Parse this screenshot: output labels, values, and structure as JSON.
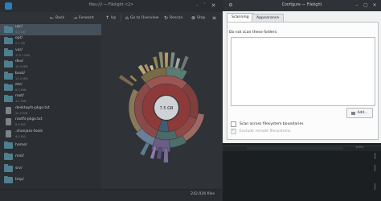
{
  "filelight": {
    "window_title": "files:/// — Filelight <2>",
    "toolbar": {
      "back": "Back",
      "forward": "Forward",
      "up": "Up",
      "go_to_overview": "Go to Overview",
      "rescan": "Rescan",
      "stop": "Stop"
    },
    "sidebar_items": [
      {
        "name": "usr/",
        "size": "4.3 GB",
        "type": "folder",
        "selected": true
      },
      {
        "name": "opt/",
        "size": "2.3 GB",
        "type": "folder"
      },
      {
        "name": "var/",
        "size": "173.1 MiB",
        "type": "folder"
      },
      {
        "name": "dev/",
        "size": "19.3 MiB",
        "type": "folder"
      },
      {
        "name": "boot/",
        "size": "12.3 MiB",
        "type": "folder"
      },
      {
        "name": "etc/",
        "size": "8.3 MiB",
        "type": "folder"
      },
      {
        "name": "root/",
        "size": "4.2 MiB",
        "type": "folder"
      },
      {
        "name": "desktopfs-pkgs.txt",
        "size": "24.2 KiB",
        "type": "file"
      },
      {
        "name": "rootfs-pkgs.txt",
        "size": "6.9 KiB",
        "type": "file"
      },
      {
        "name": ".shanjaro-tools",
        "size": "4.0 KiB",
        "type": "file"
      },
      {
        "name": "home/",
        "size": "",
        "type": "folder"
      },
      {
        "name": "mnt/",
        "size": "",
        "type": "folder"
      },
      {
        "name": "srv/",
        "size": "",
        "type": "folder"
      },
      {
        "name": "tmp/",
        "size": "",
        "type": "folder"
      }
    ],
    "chart_center_label": "7.5 GB",
    "status_files": "242,026 files"
  },
  "configure": {
    "window_title": "Configure — Filelight",
    "tabs": [
      {
        "label": "Scanning",
        "active": true
      },
      {
        "label": "Appearance",
        "active": false
      }
    ],
    "do_not_scan_label": "Do not scan these folders:",
    "add_button": "Add...",
    "scan_across_fs": "Scan across filesystem boundaries",
    "exclude_remote": "Exclude remote filesystems"
  },
  "background": {
    "percent": "100%"
  },
  "colors": {
    "selection": "#46505a",
    "folder_icon": "#4f7f8e",
    "dialog_bg": "#eff0f1"
  }
}
